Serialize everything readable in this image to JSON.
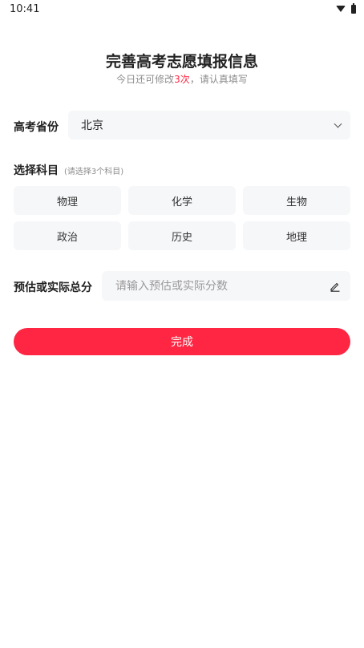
{
  "status_bar": {
    "time": "10:41"
  },
  "header": {
    "title": "完善高考志愿填报信息",
    "subtitle_prefix": "今日还可修改",
    "subtitle_count": "3次",
    "subtitle_suffix": "，请认真填写"
  },
  "province": {
    "label": "高考省份",
    "value": "北京"
  },
  "subjects": {
    "label": "选择科目",
    "hint": "(请选择3个科目)",
    "items": [
      "物理",
      "化学",
      "生物",
      "政治",
      "历史",
      "地理"
    ]
  },
  "score": {
    "label": "预估或实际总分",
    "placeholder": "请输入预估或实际分数",
    "value": ""
  },
  "submit": {
    "label": "完成"
  },
  "colors": {
    "accent": "#fe2642",
    "field_bg": "#f6f7f9"
  },
  "icons": {
    "status": [
      "wifi-icon",
      "battery-icon"
    ],
    "select": "chevron-down-icon",
    "input": "edit-pencil-icon"
  }
}
